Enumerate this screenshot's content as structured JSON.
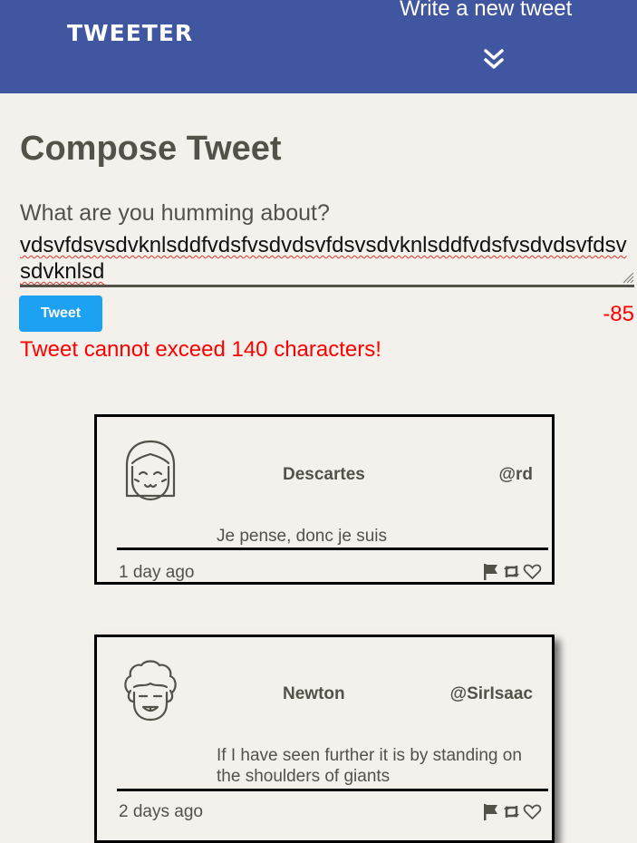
{
  "nav": {
    "logo": "TWEETER",
    "write_link": "Write a new tweet",
    "chevron_icon": "double-chevron-down-icon",
    "background": "#4056a1"
  },
  "compose": {
    "title": "Compose Tweet",
    "prompt": "What are you humming about?",
    "text_value": "vdsvfdsvsdvknlsddfvdsfvsdvdsvfdsvsdvknlsddfvdsfvsdvdsvfdsvsdvknlsd",
    "tweet_button": "Tweet",
    "counter": "-85",
    "error": "Tweet cannot exceed 140 characters!",
    "button_color": "#1da1f2",
    "error_color": "#ff0000"
  },
  "tweets": [
    {
      "name": "Descartes",
      "handle": "@rd",
      "content": "Je pense, donc je suis",
      "time": "1 day ago",
      "avatar_icon": "smiling-girl-avatar-icon"
    },
    {
      "name": "Newton",
      "handle": "@SirIsaac",
      "content": "If I have seen further it is by standing on the shoulders of giants",
      "time": "2 days ago",
      "avatar_icon": "curly-hair-man-avatar-icon"
    }
  ],
  "action_icons": [
    "flag-icon",
    "retweet-icon",
    "heart-icon"
  ]
}
